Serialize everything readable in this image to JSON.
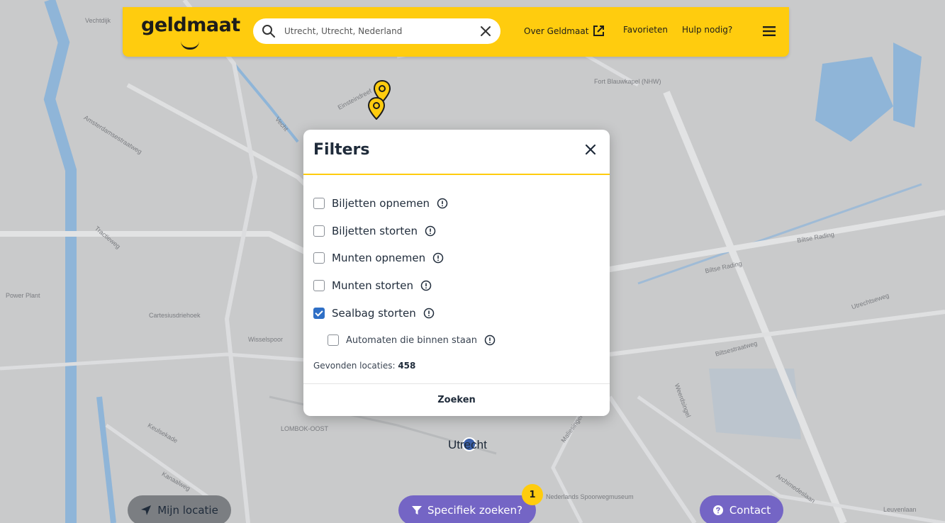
{
  "header": {
    "logo": "geldmaat",
    "search_value": "Utrecht, Utrecht, Nederland",
    "nav_over": "Over Geldmaat",
    "nav_favorites": "Favorieten",
    "nav_help": "Hulp nodig?",
    "brand_color": "#ffcc0e"
  },
  "map": {
    "labels": [
      "Vechtdijk",
      "Amsterdamsestraatweg",
      "Tractieweg",
      "Cartesiusdriehoek",
      "Wisselspoor",
      "LOMBOK-OOST",
      "Einsteindreef",
      "Fort Blauwkapel (NHW)",
      "Biltse Rading",
      "Utrechtseweg",
      "Biltsestraatweg",
      "Weerdsingel",
      "Nederlands Spoorwegmuseum",
      "Leuvenlaan",
      "Kanaalweg",
      "Keulsekade",
      "Maliesingel",
      "Archimedeslaan",
      "Biltse Rading",
      "Power Plant",
      "Vecht"
    ],
    "city": "Utrecht"
  },
  "filters": {
    "title": "Filters",
    "options": [
      {
        "label": "Biljetten opnemen",
        "checked": false
      },
      {
        "label": "Biljetten storten",
        "checked": false
      },
      {
        "label": "Munten opnemen",
        "checked": false
      },
      {
        "label": "Munten storten",
        "checked": false
      },
      {
        "label": "Sealbag storten",
        "checked": true
      }
    ],
    "sub_option": {
      "label": "Automaten die binnen staan",
      "checked": false
    },
    "found_label": "Gevonden locaties:",
    "found_count": "458",
    "search_button": "Zoeken"
  },
  "bottom": {
    "my_location": "Mijn locatie",
    "specific_search": "Specifiek zoeken?",
    "badge_count": "1",
    "contact": "Contact",
    "accent_color": "#7465c5"
  }
}
